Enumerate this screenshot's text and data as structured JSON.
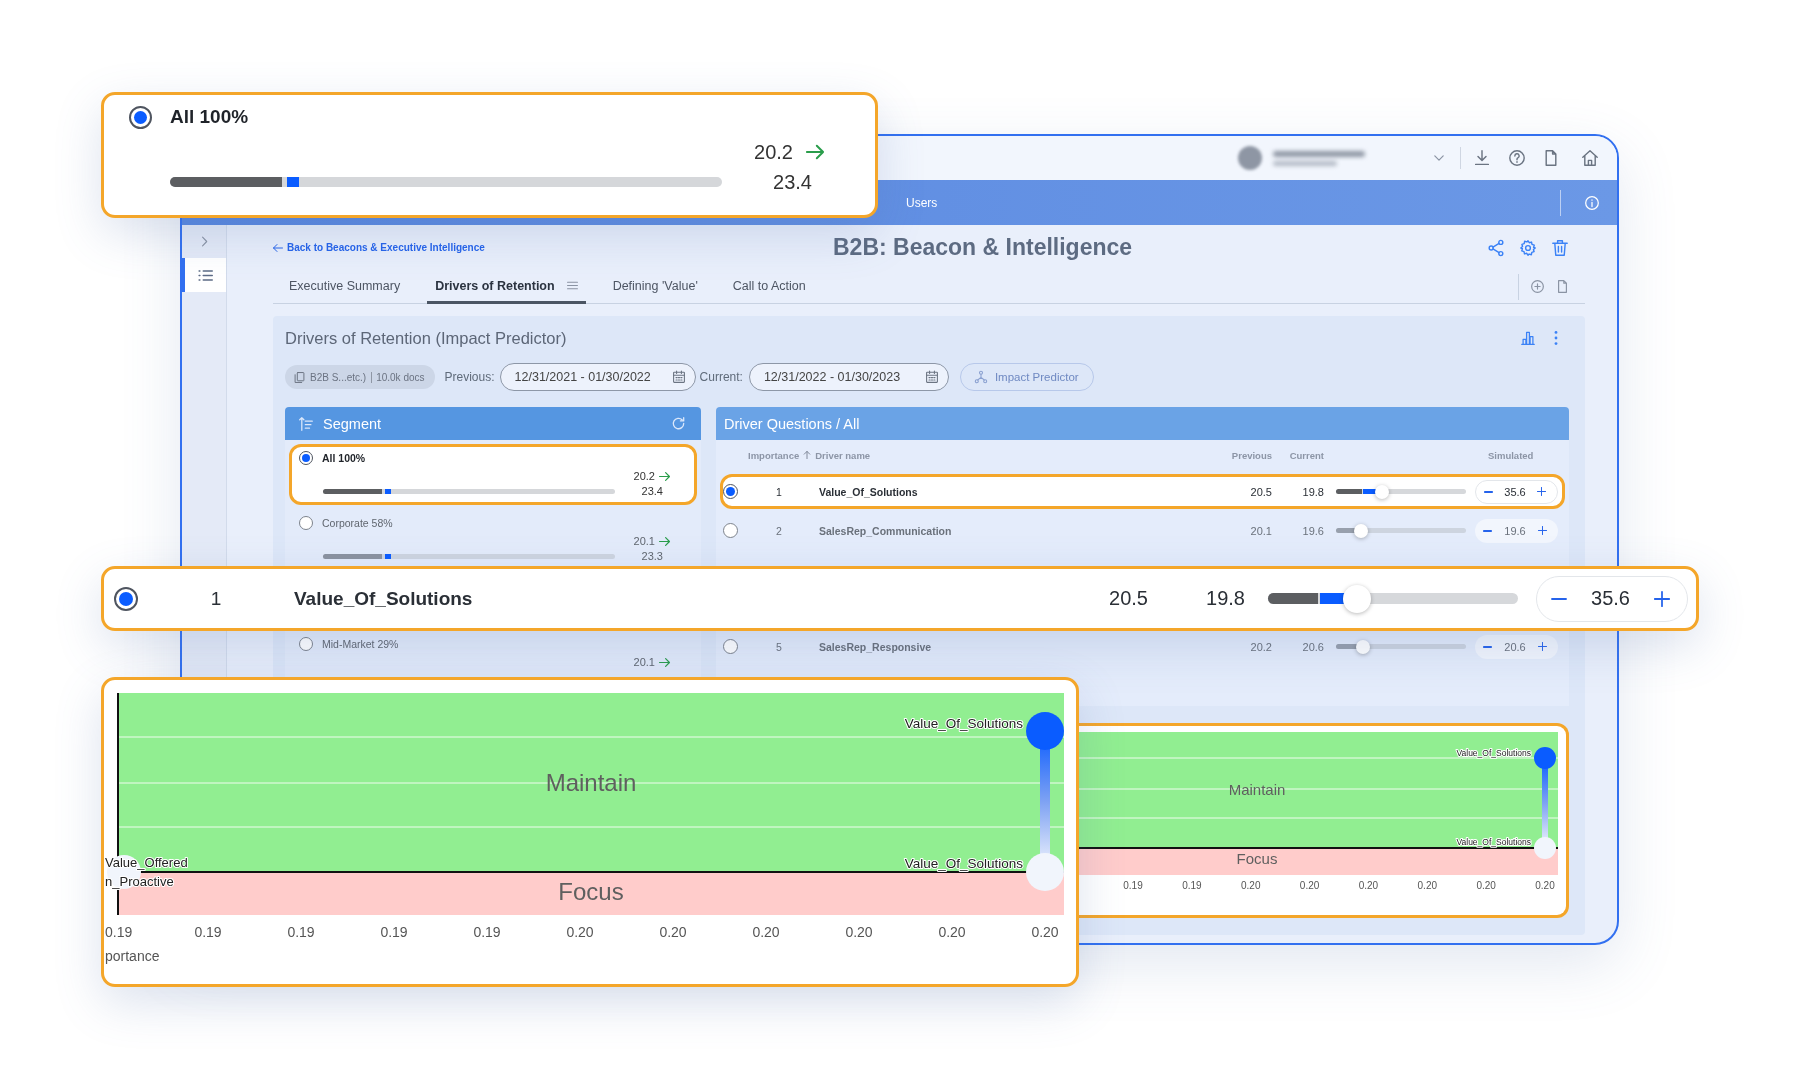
{
  "app": {
    "nav_bar": {
      "label": "Users"
    },
    "back_link": "Back to Beacons & Executive Intelligence",
    "title": "B2B: Beacon & Intelligence",
    "tabs": [
      {
        "label": "Executive Summary",
        "selected": false
      },
      {
        "label": "Drivers of Retention",
        "selected": true
      },
      {
        "label": "Defining 'Value'",
        "selected": false
      },
      {
        "label": "Call to Action",
        "selected": false
      }
    ],
    "card": {
      "title": "Drivers of Retention (Impact Predictor)",
      "source_chip": {
        "name": "B2B S...etc.)",
        "count": "10.0k docs"
      },
      "previous": {
        "label": "Previous:",
        "value": "12/31/2021 - 01/30/2022"
      },
      "current": {
        "label": "Current:",
        "value": "12/31/2022 - 01/30/2023"
      },
      "impact_button": {
        "label": "Impact Predictor",
        "disabled": true
      }
    },
    "segment_panel": {
      "title": "Segment",
      "rows": [
        {
          "label": "All 100%",
          "selected": true,
          "previous": "20.2",
          "current": "23.4",
          "bar": {
            "base": {
              "level": 0.202
            },
            "current": {
              "level": 0.234
            }
          }
        },
        {
          "label": "Corporate 58%",
          "selected": false,
          "previous": "20.1",
          "current": "23.3",
          "bar": {
            "base": {
              "level": 0.201
            },
            "current": {
              "level": 0.233
            }
          }
        },
        {
          "label": "Mid-Market 29%",
          "selected": false,
          "previous": "20.1"
        }
      ]
    },
    "drivers_panel": {
      "title": "Driver Questions / All",
      "columns": {
        "importance": "Importance",
        "driver_name": "Driver name",
        "previous": "Previous",
        "current": "Current",
        "simulated": "Simulated"
      },
      "rows": [
        {
          "rank": "1",
          "name": "Value_Of_Solutions",
          "selected": true,
          "previous": "20.5",
          "current": "19.8",
          "slider": {
            "base": {
              "level": 0.198
            },
            "thumb": {
              "level": 0.356
            }
          },
          "simulated": "35.6"
        },
        {
          "rank": "2",
          "name": "SalesRep_Communication",
          "selected": false,
          "previous": "20.1",
          "current": "19.6",
          "slider": {
            "base": {
              "level": 0.196
            },
            "thumb": {
              "level": 0.196
            }
          },
          "simulated": "19.6"
        },
        {
          "rank": "5",
          "name": "SalesRep_Responsive",
          "selected": false,
          "previous": "20.2",
          "current": "20.6",
          "slider": {
            "base": {
              "level": 0.206
            },
            "thumb": {
              "level": 0.206
            }
          },
          "simulated": "20.6"
        }
      ]
    },
    "chart_panel": {
      "zone_labels": {
        "maintain": "Maintain",
        "focus": "Focus"
      },
      "point_labels": [
        "Value_Of_Solutions",
        "Value_Of_Solutions"
      ],
      "x_tick_labels": [
        "0.19",
        "0.19",
        "0.20",
        "0.20",
        "0.20",
        "0.20",
        "0.20",
        "0.20"
      ]
    }
  },
  "callouts": [
    {
      "kind": "segment_row",
      "label": "All 100%",
      "selected": true,
      "previous": "20.2",
      "current": "23.4",
      "bar": {
        "base": {
          "level": 0.202
        },
        "current": {
          "level": 0.234
        }
      }
    },
    {
      "kind": "driver_row",
      "rank": "1",
      "name": "Value_Of_Solutions",
      "selected": true,
      "previous": "20.5",
      "current": "19.8",
      "slider": {
        "base": {
          "level": 0.198
        },
        "thumb": {
          "level": 0.356
        }
      },
      "simulated": "35.6"
    },
    {
      "kind": "chart",
      "zone_labels": {
        "maintain": "Maintain",
        "focus": "Focus"
      },
      "point_labels": [
        "Value_Of_Solutions",
        "Value_Of_Solutions"
      ],
      "left_labels": [
        "Value_Offered",
        "n_Proactive"
      ],
      "x_tick_labels": [
        "0.19",
        "0.19",
        "0.19",
        "0.19",
        "0.19",
        "0.20",
        "0.20",
        "0.20",
        "0.20",
        "0.20",
        "0.20"
      ],
      "x_axis_title": "portance"
    }
  ]
}
